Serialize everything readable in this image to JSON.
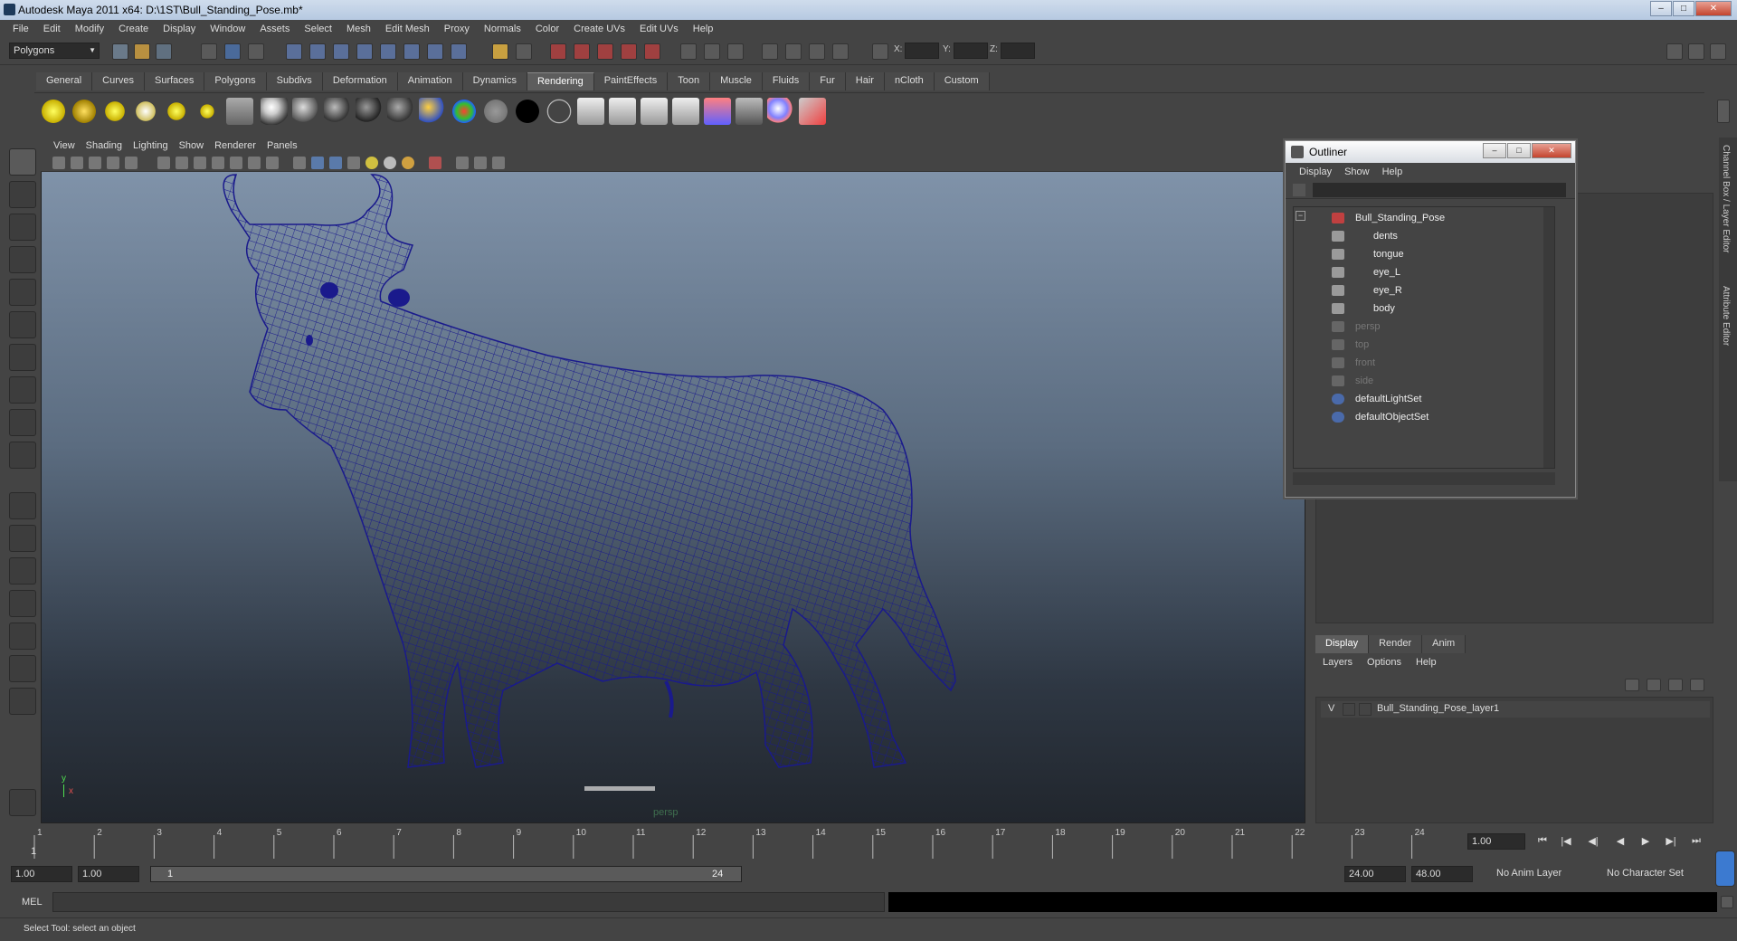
{
  "window": {
    "title": "Autodesk Maya 2011 x64: D:\\1ST\\Bull_Standing_Pose.mb*",
    "min": "–",
    "max": "□",
    "close": "✕"
  },
  "menubar": [
    "File",
    "Edit",
    "Modify",
    "Create",
    "Display",
    "Window",
    "Assets",
    "Select",
    "Mesh",
    "Edit Mesh",
    "Proxy",
    "Normals",
    "Color",
    "Create UVs",
    "Edit UVs",
    "Help"
  ],
  "status": {
    "mode": "Polygons",
    "x_label": "X:",
    "y_label": "Y:",
    "z_label": "Z:"
  },
  "shelf": {
    "tabs": [
      "General",
      "Curves",
      "Surfaces",
      "Polygons",
      "Subdivs",
      "Deformation",
      "Animation",
      "Dynamics",
      "Rendering",
      "PaintEffects",
      "Toon",
      "Muscle",
      "Fluids",
      "Fur",
      "Hair",
      "nCloth",
      "Custom"
    ],
    "active": "Rendering"
  },
  "viewport": {
    "menu": [
      "View",
      "Shading",
      "Lighting",
      "Show",
      "Renderer",
      "Panels"
    ],
    "camera": "persp",
    "axis_y": "y",
    "axis_x": "x",
    "wire_color": "#1a1a8c"
  },
  "outliner": {
    "title": "Outliner",
    "menu": [
      "Display",
      "Show",
      "Help"
    ],
    "collapse": "−",
    "items": [
      {
        "label": "Bull_Standing_Pose",
        "dim": false
      },
      {
        "label": "dents",
        "dim": false
      },
      {
        "label": "tongue",
        "dim": false
      },
      {
        "label": "eye_L",
        "dim": false
      },
      {
        "label": "eye_R",
        "dim": false
      },
      {
        "label": "body",
        "dim": false
      },
      {
        "label": "persp",
        "dim": true
      },
      {
        "label": "top",
        "dim": true
      },
      {
        "label": "front",
        "dim": true
      },
      {
        "label": "side",
        "dim": true
      },
      {
        "label": "defaultLightSet",
        "dim": false
      },
      {
        "label": "defaultObjectSet",
        "dim": false
      }
    ]
  },
  "side_tabs": [
    "Channel Box / Layer Editor",
    "Attribute Editor"
  ],
  "layers": {
    "tabs": [
      "Display",
      "Render",
      "Anim"
    ],
    "active": "Display",
    "menu": [
      "Layers",
      "Options",
      "Help"
    ],
    "rows": [
      {
        "v": "V",
        "name": "Bull_Standing_Pose_layer1"
      }
    ]
  },
  "timeline": {
    "ticks": [
      "1",
      "2",
      "3",
      "4",
      "5",
      "6",
      "7",
      "8",
      "9",
      "10",
      "11",
      "12",
      "13",
      "14",
      "15",
      "16",
      "17",
      "18",
      "19",
      "20",
      "21",
      "22",
      "23",
      "24"
    ],
    "current_frame": "1",
    "current_time": "1.00"
  },
  "range": {
    "start_time": "1.00",
    "playback_start": "1.00",
    "range_start": "1",
    "range_end": "24",
    "playback_end": "24.00",
    "end_time": "48.00",
    "anim_layer": "No Anim Layer",
    "char_set": "No Character Set"
  },
  "playback": [
    "⏮",
    "|◀",
    "◀|",
    "◀",
    "▶",
    "▶|",
    "⏭"
  ],
  "command": {
    "label": "MEL"
  },
  "help": "Select Tool: select an object"
}
